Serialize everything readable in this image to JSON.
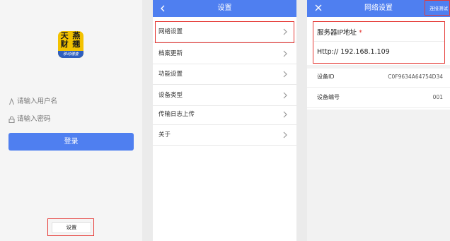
{
  "login": {
    "logo_text_line1": "天 燕",
    "logo_text_line2": "财 翘",
    "logo_band": "移动稽查",
    "username_placeholder": "请输入用户名",
    "password_placeholder": "请输入密码",
    "login_button": "登录",
    "settings_button": "设置"
  },
  "settings": {
    "title": "设置",
    "back_icon": "chevron-left-icon",
    "items": [
      {
        "label": "网络设置"
      },
      {
        "label": "档案更新"
      },
      {
        "label": "功能设置"
      },
      {
        "label": "设备类型"
      },
      {
        "label": "传输日志上传"
      },
      {
        "label": "关于"
      }
    ]
  },
  "network": {
    "title": "网络设置",
    "close_icon": "close-icon",
    "test_link": "连接测试",
    "server_label": "服务器IP地址",
    "required_mark": "*",
    "server_value": "Http:// 192.168.1.109",
    "device_id_label": "设备ID",
    "device_id_value": "C0F9634A64754D34",
    "device_no_label": "设备编号",
    "device_no_value": "001"
  },
  "colors": {
    "accent": "#4f7ff0",
    "highlight": "#e53935",
    "logo_yellow": "#f3c200"
  }
}
